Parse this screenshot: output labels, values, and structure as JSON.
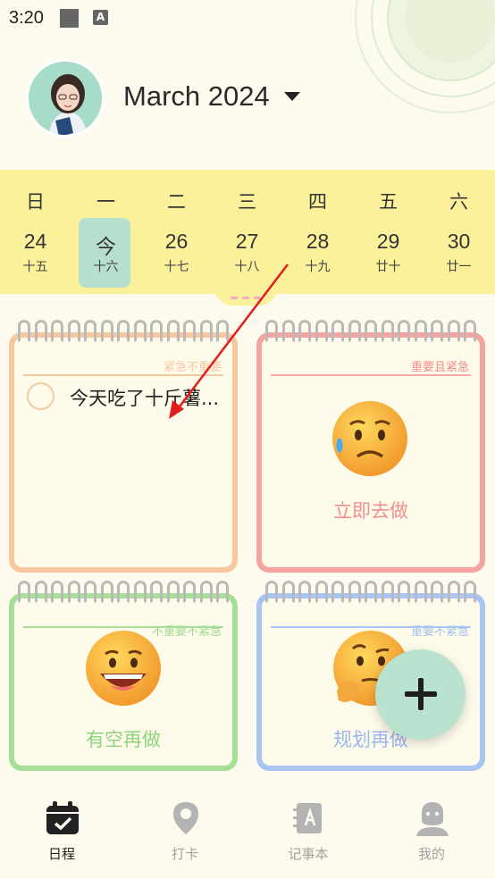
{
  "status_bar": {
    "time": "3:20",
    "notif_glyph": "A"
  },
  "header": {
    "month_title": "March 2024"
  },
  "week": {
    "weekdays": [
      "日",
      "一",
      "二",
      "三",
      "四",
      "五",
      "六"
    ],
    "days": [
      {
        "date": "24",
        "lunar": "十五"
      },
      {
        "date": "今",
        "lunar": "十六"
      },
      {
        "date": "26",
        "lunar": "十七"
      },
      {
        "date": "27",
        "lunar": "十八"
      },
      {
        "date": "28",
        "lunar": "十九"
      },
      {
        "date": "29",
        "lunar": "廿十"
      },
      {
        "date": "30",
        "lunar": "廿一"
      }
    ]
  },
  "quadrants": {
    "q1": {
      "tag": "紧急不重要",
      "task": "今天吃了十斤薯..."
    },
    "q2": {
      "tag": "重要且紧急",
      "caption": "立即去做"
    },
    "q3": {
      "tag": "不重要不紧急",
      "caption": "有空再做"
    },
    "q4": {
      "tag": "重要不紧急",
      "caption": "规划再做"
    }
  },
  "nav": {
    "items": [
      {
        "label": "日程",
        "icon": "calendar-check-icon",
        "active": true
      },
      {
        "label": "打卡",
        "icon": "location-pin-icon",
        "active": false
      },
      {
        "label": "记事本",
        "icon": "notebook-icon",
        "active": false
      },
      {
        "label": "我的",
        "icon": "user-icon",
        "active": false
      }
    ]
  },
  "colors": {
    "background": "#fdfbed",
    "week_strip": "#fcf19b",
    "today_highlight": "#b7dfcd",
    "fab": "#b9e3cf",
    "q1_border": "#f9c79d",
    "q2_border": "#f6a3a0",
    "q3_border": "#a6df97",
    "q4_border": "#a9c5f4",
    "nav_active": "#222222",
    "nav_inactive": "#a0a0a0",
    "annotation_arrow": "#e11d1d"
  }
}
